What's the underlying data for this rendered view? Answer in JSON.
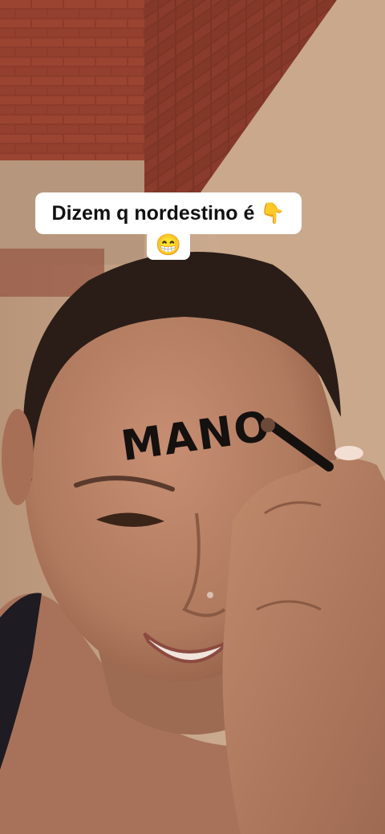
{
  "caption": {
    "line1": "Dizem q nordestino é 👇",
    "line2": "😁"
  },
  "forehead_text": "MANO",
  "colors": {
    "brick": "#8a3a2a",
    "wall": "#caa98a",
    "skin": "#b98064",
    "hair": "#2a1d17",
    "caption_bg": "#ffffff",
    "caption_text": "#111111"
  }
}
